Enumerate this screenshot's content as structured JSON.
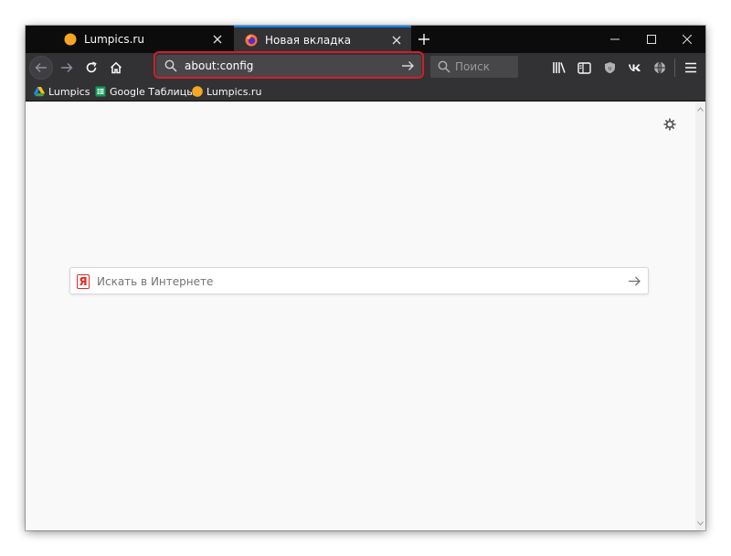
{
  "tabs": [
    {
      "title": "Lumpics.ru",
      "favicon": "lumpics-orange-circle-icon",
      "active": false
    },
    {
      "title": "Новая вкладка",
      "favicon": "firefox-icon",
      "active": true
    }
  ],
  "window_controls": [
    "minimize-icon",
    "maximize-icon",
    "close-icon"
  ],
  "navbar": {
    "url_value": "about:config",
    "search_placeholder": "Поиск",
    "icons": [
      "back-arrow-icon",
      "forward-arrow-icon",
      "reload-icon",
      "home-icon",
      "library-icon",
      "sidebar-icon",
      "shield-addon-icon",
      "vk-icon",
      "globe-icon",
      "hamburger-menu-icon"
    ]
  },
  "bookmarks": [
    {
      "label": "Lumpics",
      "icon": "google-drive-icon"
    },
    {
      "label": "Google Таблицы",
      "icon": "google-sheets-icon"
    },
    {
      "label": "Lumpics.ru",
      "icon": "lumpics-orange-circle-icon"
    }
  ],
  "newtab": {
    "search_placeholder": "Искать в Интернете",
    "engine_icon_glyph": "Я"
  },
  "colors": {
    "tabbar_bg": "#0c0c0d",
    "toolbar_bg": "#323234",
    "urlbar_bg": "#474749",
    "highlight": "#d11e2d",
    "active_tab_accent": "#0a84ff",
    "content_bg": "#f9f9fa"
  }
}
